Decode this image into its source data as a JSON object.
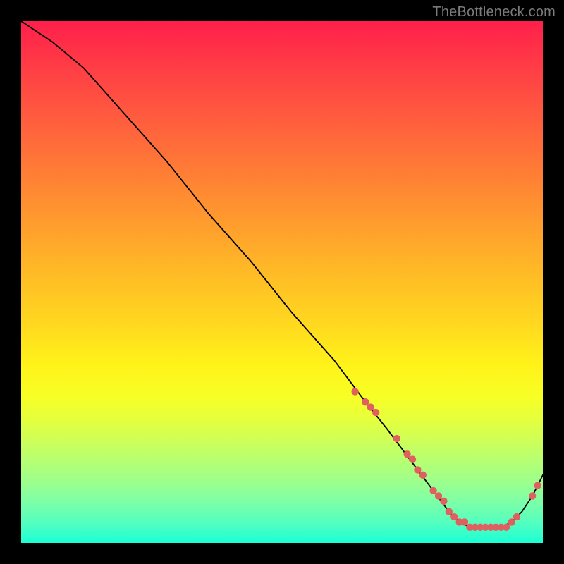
{
  "watermark": "TheBottleneck.com",
  "chart_data": {
    "type": "line",
    "title": "",
    "xlabel": "",
    "ylabel": "",
    "xlim": [
      0,
      100
    ],
    "ylim": [
      0,
      100
    ],
    "x": [
      0,
      6,
      12,
      20,
      28,
      36,
      44,
      52,
      60,
      66,
      70,
      73,
      76,
      79,
      82,
      84,
      86,
      88,
      90,
      92,
      94,
      96,
      98,
      100
    ],
    "y": [
      100,
      96,
      91,
      82,
      73,
      63,
      54,
      44,
      35,
      27,
      22,
      18,
      14,
      10,
      6,
      4,
      3,
      3,
      3,
      3,
      4,
      6,
      9,
      13
    ],
    "markers_x": [
      64,
      66,
      67,
      68,
      72,
      74,
      75,
      76,
      77,
      79,
      80,
      81,
      82,
      83,
      84,
      85,
      86,
      87,
      88,
      89,
      90,
      91,
      92,
      93,
      94,
      95,
      98,
      99
    ],
    "markers_y": [
      29,
      27,
      26,
      25,
      20,
      17,
      16,
      14,
      13,
      10,
      9,
      8,
      6,
      5,
      4,
      4,
      3,
      3,
      3,
      3,
      3,
      3,
      3,
      3,
      4,
      5,
      9,
      11
    ],
    "legend": [],
    "grid": false
  }
}
